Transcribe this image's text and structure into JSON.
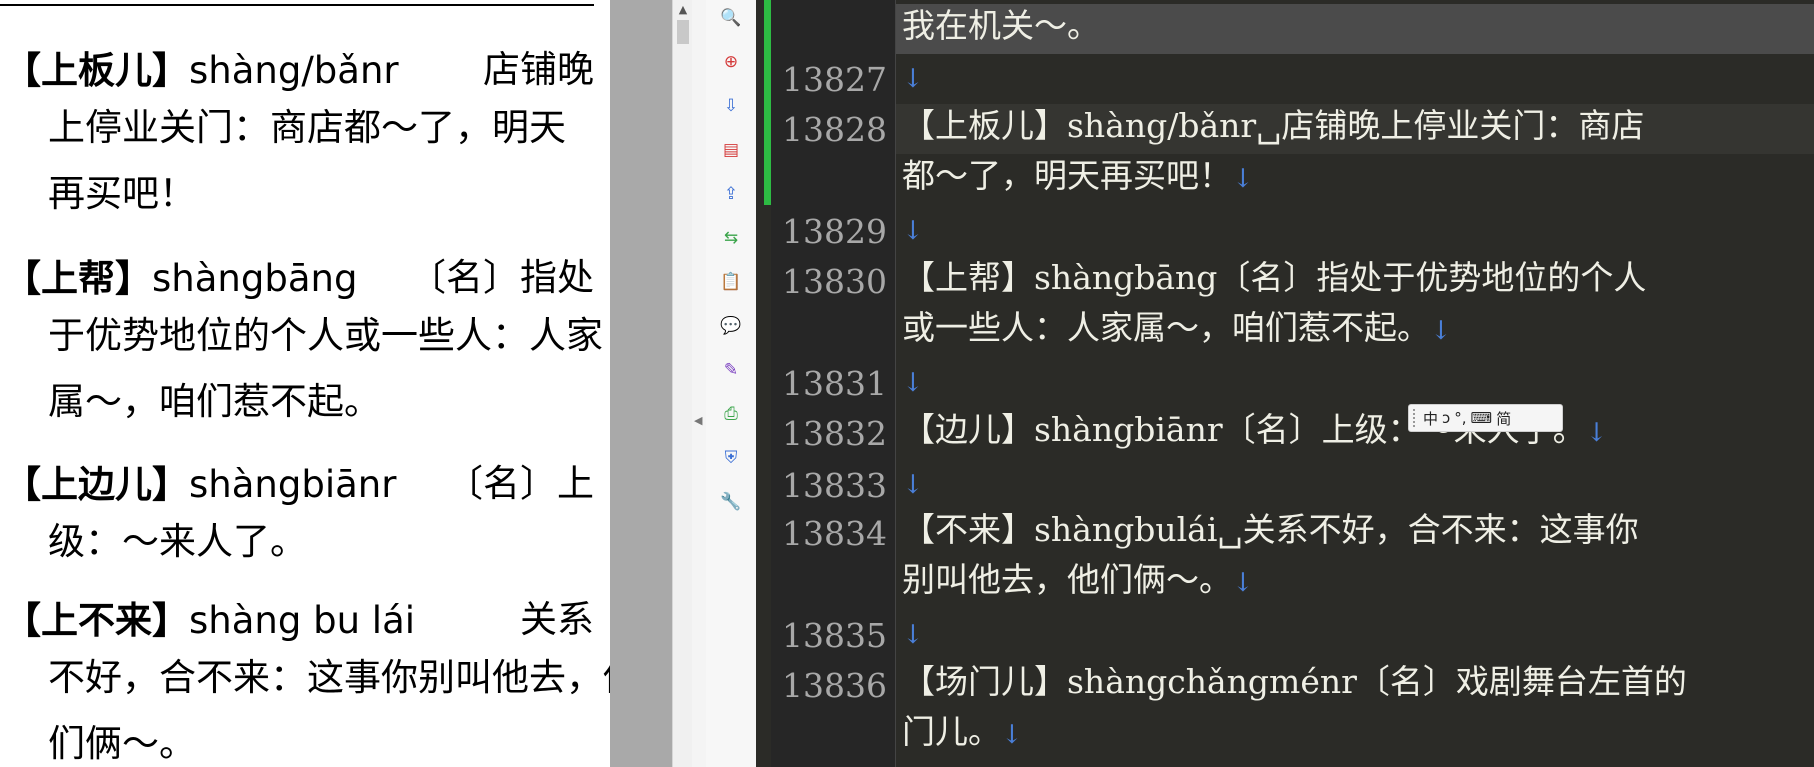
{
  "document": {
    "entries": [
      {
        "head": "【上板儿】",
        "pinyin": "shàng/bǎnr",
        "lines": [
          "店铺晚",
          "上停业关门：商店都～了，明天",
          "再买吧！"
        ]
      },
      {
        "head": "【上帮】",
        "pinyin": "shàngbāng",
        "lines": [
          "〔名〕指处",
          "于优势地位的个人或一些人：人家",
          "属～，咱们惹不起。"
        ]
      },
      {
        "head": "【上边儿】",
        "pinyin": "shàngbiānr",
        "lines": [
          "〔名〕上",
          "级：～来人了。"
        ]
      },
      {
        "head": "【上不来】",
        "pinyin": "shàng bu lái",
        "lines": [
          "关系",
          "不好，合不来：这事你别叫他去，他",
          "们俩～。"
        ]
      }
    ]
  },
  "tools": [
    "zoom-icon",
    "pdf-add-icon",
    "import-icon",
    "layout-icon",
    "export-icon",
    "extract-icon",
    "clipboard-icon",
    "comment-icon",
    "signature-icon",
    "print-icon",
    "shield-icon",
    "tools-icon"
  ],
  "editor": {
    "lines": [
      {
        "num": "",
        "text": "我在机关～。",
        "ret": false,
        "hl": "hl"
      },
      {
        "num": "13827",
        "text": "",
        "ret": true
      },
      {
        "num": "13828",
        "text": "【上板儿】shàng/bǎnr␣店铺晚上停业关门：商店",
        "ret": false,
        "hl": "hl2"
      },
      {
        "num": "",
        "text": "都～了，明天再买吧！",
        "ret": true
      },
      {
        "num": "13829",
        "text": "",
        "ret": true
      },
      {
        "num": "13830",
        "text": "【上帮】shàngbāng〔名〕指处于优势地位的个人",
        "ret": false
      },
      {
        "num": "",
        "text": "或一些人：人家属～，咱们惹不起。",
        "ret": true
      },
      {
        "num": "13831",
        "text": "",
        "ret": true
      },
      {
        "num": "13832",
        "text": "【边儿】shàngbiānr〔名〕上级：～来人了。",
        "ret": true
      },
      {
        "num": "13833",
        "text": "",
        "ret": true
      },
      {
        "num": "13834",
        "text": "【不来】shàngbulái␣关系不好，合不来：这事你",
        "ret": false
      },
      {
        "num": "",
        "text": "别叫他去，他们俩～。",
        "ret": true
      },
      {
        "num": "13835",
        "text": "",
        "ret": true
      },
      {
        "num": "13836",
        "text": "【场门儿】shàngchǎngménr〔名〕戏剧舞台左首的",
        "ret": false
      },
      {
        "num": "",
        "text": "门儿。",
        "ret": true
      }
    ],
    "return_glyph": "↓"
  },
  "ime": {
    "items": [
      "中",
      "ↄ",
      "°,",
      "⌨",
      "简"
    ]
  },
  "colors": {
    "change_bar": "#2dbb43",
    "return_mark": "#4a7fd8"
  }
}
